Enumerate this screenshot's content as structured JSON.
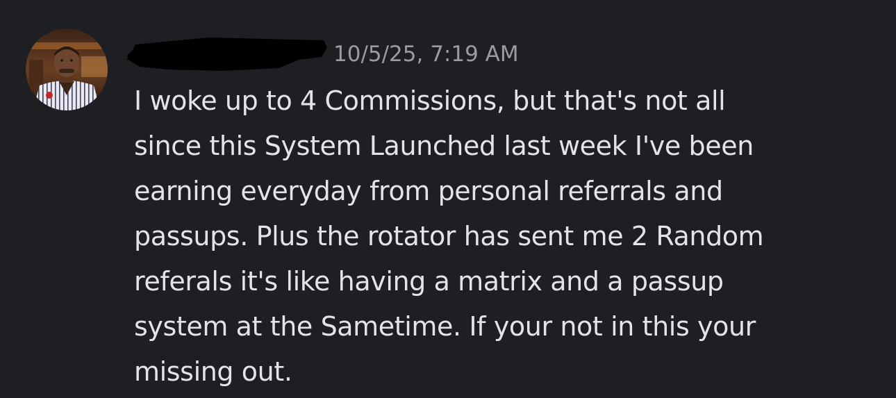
{
  "message": {
    "author_redacted": true,
    "timestamp": "10/5/25, 7:19 AM",
    "lines": [
      "I woke up to 4 Commissions, but that's not all",
      "since this System Launched last week I've been",
      "earning everyday from personal referrals and",
      "passups. Plus the rotator has sent me 2 Random",
      "referals it's like having a matrix and a passup",
      "system at the Sametime. If your not in this your",
      "missing out."
    ]
  },
  "colors": {
    "background": "#1e1f23",
    "text": "#e3e4e8",
    "timestamp": "#9a9ca3",
    "redaction": "#000000"
  }
}
